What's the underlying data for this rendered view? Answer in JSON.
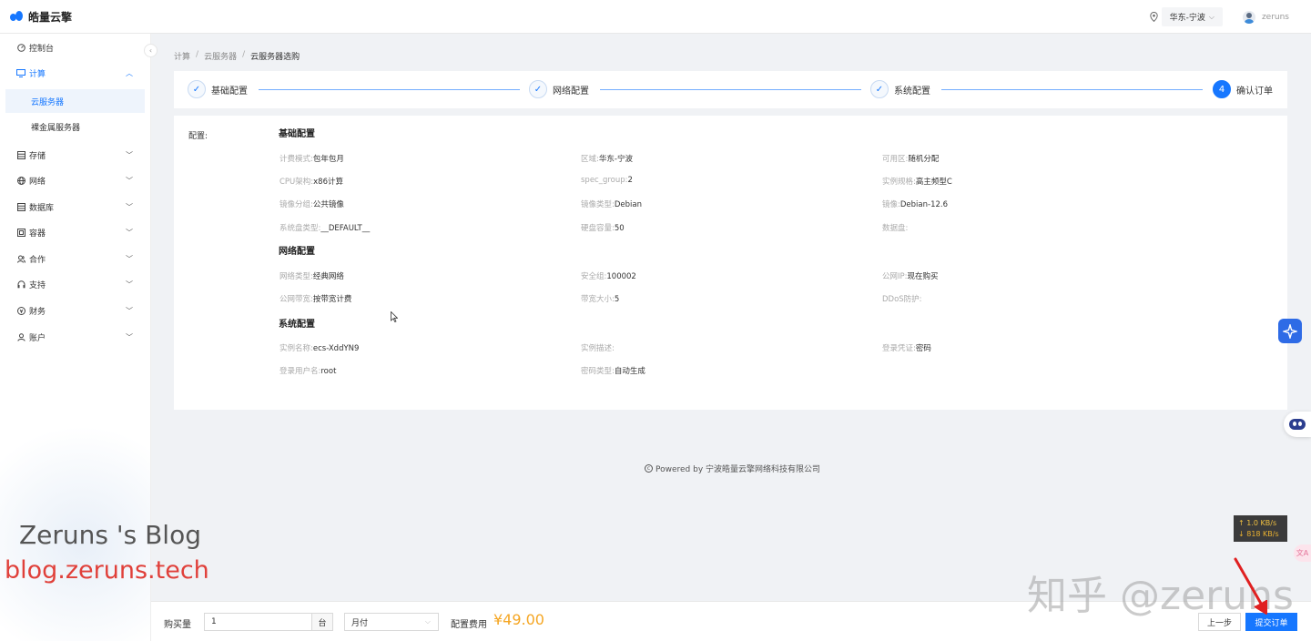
{
  "app": {
    "logo_text": "皓量云擎"
  },
  "header": {
    "region": "华东-宁波",
    "username": "zeruns"
  },
  "sidebar": {
    "items": [
      {
        "label": "控制台",
        "icon": "dashboard-icon"
      },
      {
        "label": "计算",
        "icon": "monitor-icon"
      },
      {
        "label": "存储",
        "icon": "storage-icon"
      },
      {
        "label": "网络",
        "icon": "globe-icon"
      },
      {
        "label": "数据库",
        "icon": "database-icon"
      },
      {
        "label": "容器",
        "icon": "container-icon"
      },
      {
        "label": "合作",
        "icon": "partner-icon"
      },
      {
        "label": "支持",
        "icon": "headset-icon"
      },
      {
        "label": "财务",
        "icon": "finance-icon"
      },
      {
        "label": "账户",
        "icon": "user-icon"
      }
    ],
    "sub_items": [
      {
        "label": "云服务器"
      },
      {
        "label": "裸金属服务器"
      }
    ]
  },
  "breadcrumb": [
    "计算",
    "云服务器",
    "云服务器选购"
  ],
  "steps": [
    {
      "label": "基础配置",
      "mark": "✓"
    },
    {
      "label": "网络配置",
      "mark": "✓"
    },
    {
      "label": "系统配置",
      "mark": "✓"
    },
    {
      "label": "确认订单",
      "mark": "4"
    }
  ],
  "config": {
    "label": "配置:",
    "sections": [
      {
        "title": "基础配置",
        "fields": [
          {
            "key": "计费模式:",
            "value": "包年包月"
          },
          {
            "key": "区域:",
            "value": "华东-宁波"
          },
          {
            "key": "可用区:",
            "value": "随机分配"
          },
          {
            "key": "CPU架构:",
            "value": "x86计算"
          },
          {
            "key": "spec_group:",
            "value": "2"
          },
          {
            "key": "实例规格:",
            "value": "高主频型C"
          },
          {
            "key": "镜像分组:",
            "value": "公共镜像"
          },
          {
            "key": "镜像类型:",
            "value": "Debian"
          },
          {
            "key": "镜像:",
            "value": "Debian-12.6"
          },
          {
            "key": "系统盘类型:",
            "value": "__DEFAULT__"
          },
          {
            "key": "硬盘容量:",
            "value": "50"
          },
          {
            "key": "数据盘:",
            "value": ""
          }
        ]
      },
      {
        "title": "网络配置",
        "fields": [
          {
            "key": "网络类型:",
            "value": "经典网络"
          },
          {
            "key": "安全组:",
            "value": "100002"
          },
          {
            "key": "公网IP:",
            "value": "现在购买"
          },
          {
            "key": "公网带宽:",
            "value": "按带宽计费"
          },
          {
            "key": "带宽大小:",
            "value": "5"
          },
          {
            "key": "DDoS防护:",
            "value": ""
          }
        ]
      },
      {
        "title": "系统配置",
        "fields": [
          {
            "key": "实例名称:",
            "value": "ecs-XddYN9"
          },
          {
            "key": "实例描述:",
            "value": ""
          },
          {
            "key": "登录凭证:",
            "value": "密码"
          },
          {
            "key": "登录用户名:",
            "value": "root"
          },
          {
            "key": "密码类型:",
            "value": "自动生成"
          }
        ]
      }
    ]
  },
  "footer": {
    "text": "Powered by 宁波皓量云擎网络科技有限公司"
  },
  "netspeed": {
    "up": "↑ 1.0 KB/s",
    "down": "↓ 818 KB/s"
  },
  "watermarks": {
    "blog_title": "Zeruns 's Blog",
    "blog_url": "blog.zeruns.tech",
    "zhihu": "知乎 @zeruns"
  },
  "order": {
    "quantity_label": "购买量",
    "quantity_value": "1",
    "quantity_unit": "台",
    "period": "月付",
    "fee_label": "配置费用",
    "fee_value": "¥49.00",
    "prev_label": "上一步",
    "submit_label": "提交订单"
  },
  "colors": {
    "primary": "#1677ff",
    "price": "#f5a623",
    "annotation_arrow": "#e02020"
  }
}
